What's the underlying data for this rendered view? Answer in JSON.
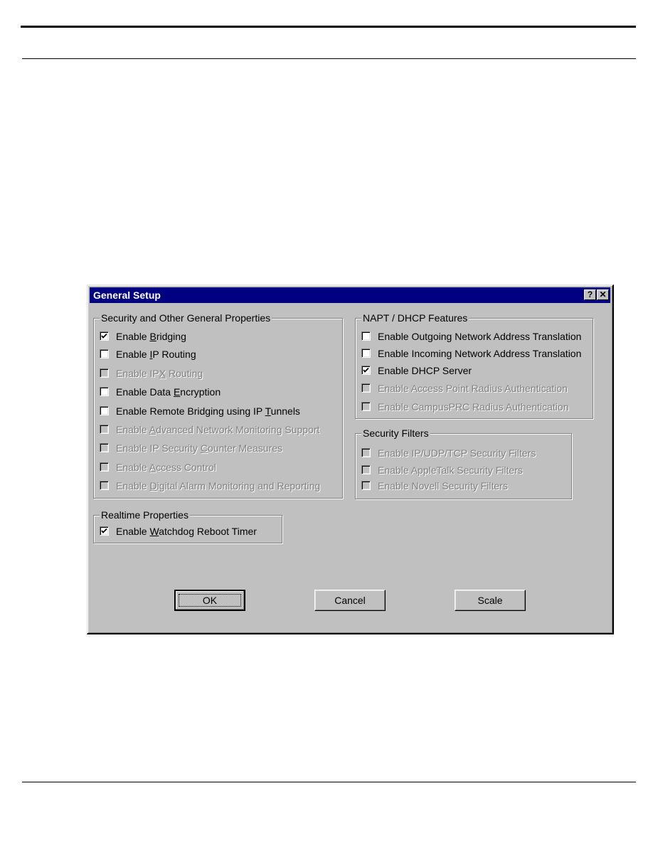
{
  "page": {
    "rules": [
      "top-thick",
      "top-thin",
      "bottom-thin"
    ]
  },
  "dialog": {
    "title": "General Setup",
    "title_buttons": {
      "help": "?",
      "close": "✕"
    },
    "groups": {
      "security": {
        "label": "Security and Other General Properties",
        "items": [
          {
            "label": "Enable Bridging",
            "mnemonic": "B",
            "checked": true,
            "enabled": true
          },
          {
            "label": "Enable IP Routing",
            "mnemonic": "I",
            "checked": false,
            "enabled": true
          },
          {
            "label": "Enable IPX Routing",
            "mnemonic": "X",
            "checked": false,
            "enabled": false
          },
          {
            "label": "Enable Data Encryption",
            "mnemonic": "E",
            "checked": false,
            "enabled": true
          },
          {
            "label": "Enable Remote Bridging using IP Tunnels",
            "mnemonic": "T",
            "checked": false,
            "enabled": true
          },
          {
            "label": "Enable Advanced Network Monitoring Support",
            "mnemonic": "A",
            "checked": false,
            "enabled": false
          },
          {
            "label": "Enable IP Security Counter Measures",
            "mnemonic": "C",
            "checked": false,
            "enabled": false
          },
          {
            "label": "Enable Access Control",
            "mnemonic": "A",
            "checked": false,
            "enabled": false
          },
          {
            "label": "Enable Digital Alarm Monitoring and Reporting",
            "mnemonic": "D",
            "checked": false,
            "enabled": false
          }
        ]
      },
      "napt": {
        "label": "NAPT / DHCP Features",
        "items": [
          {
            "label": "Enable Outgoing Network Address Translation",
            "checked": false,
            "enabled": true
          },
          {
            "label": "Enable Incoming Network Address Translation",
            "checked": false,
            "enabled": true
          },
          {
            "label": "Enable DHCP Server",
            "checked": true,
            "enabled": true
          },
          {
            "label": "Enable Access Point Radius Authentication",
            "checked": false,
            "enabled": false
          },
          {
            "label": "Enable CampusPRC Radius Authentication",
            "checked": false,
            "enabled": false
          }
        ]
      },
      "filters": {
        "label": "Security Filters",
        "items": [
          {
            "label": "Enable IP/UDP/TCP Security Filters",
            "checked": false,
            "enabled": false
          },
          {
            "label": "Enable AppleTalk Security Filters",
            "checked": false,
            "enabled": false
          },
          {
            "label": "Enable Novell Security Filters",
            "checked": false,
            "enabled": false
          }
        ]
      },
      "realtime": {
        "label": "Realtime Properties",
        "items": [
          {
            "label": "Enable Watchdog Reboot Timer",
            "mnemonic": "W",
            "checked": true,
            "enabled": true
          }
        ]
      }
    },
    "buttons": {
      "ok": "OK",
      "cancel": "Cancel",
      "scale": "Scale"
    },
    "colors": {
      "titlebar": "#000080",
      "face": "#c0c0c0",
      "disabled_text": "#808080"
    }
  }
}
